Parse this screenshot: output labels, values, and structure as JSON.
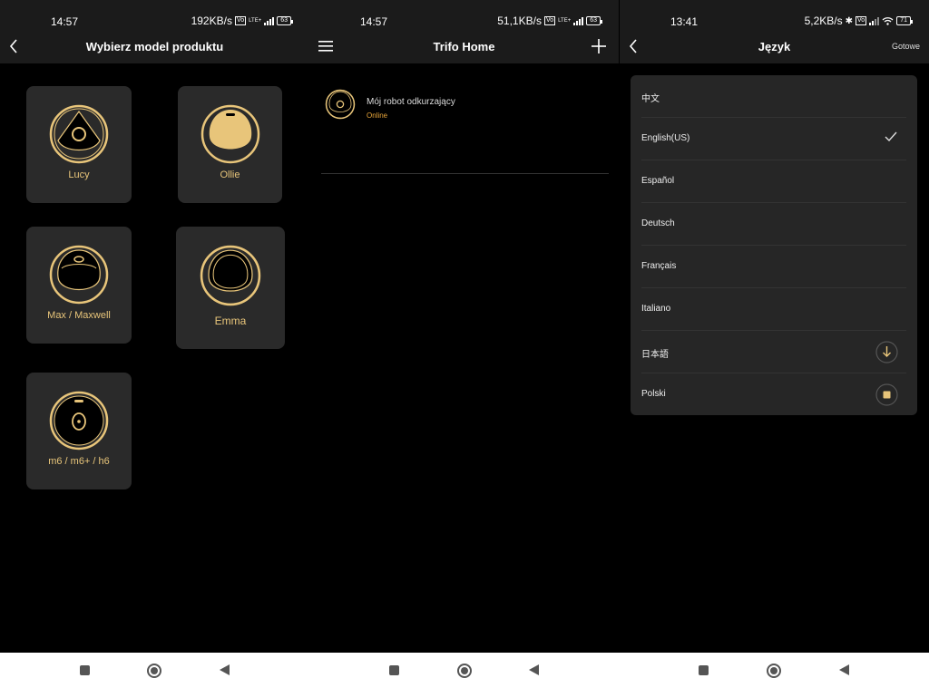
{
  "panel1": {
    "status": {
      "time": "14:57",
      "speed": "192KB/s",
      "net": "LTE+",
      "battery": "63"
    },
    "title": "Wybierz model produktu",
    "models": [
      {
        "label": "Lucy"
      },
      {
        "label": "Ollie"
      },
      {
        "label": "Max / Maxwell"
      },
      {
        "label": "Emma"
      },
      {
        "label": "m6 / m6+ / h6"
      }
    ]
  },
  "panel2": {
    "status": {
      "time": "14:57",
      "speed": "51,1KB/s",
      "net": "LTE+",
      "battery": "63"
    },
    "title": "Trifo Home",
    "device": {
      "name": "Mój robot odkurzający",
      "status": "Online"
    }
  },
  "panel3": {
    "status": {
      "time": "13:41",
      "speed": "5,2KB/s",
      "battery": "71"
    },
    "title": "Język",
    "done": "Gotowe",
    "languages": [
      {
        "label": "中文",
        "icon": ""
      },
      {
        "label": "English(US)",
        "icon": "check-icon"
      },
      {
        "label": "Español",
        "icon": ""
      },
      {
        "label": "Deutsch",
        "icon": ""
      },
      {
        "label": "Français",
        "icon": ""
      },
      {
        "label": "Italiano",
        "icon": ""
      },
      {
        "label": "日本語",
        "icon": "download-icon"
      },
      {
        "label": "Polski",
        "icon": "stop-icon"
      }
    ]
  },
  "colors": {
    "accent": "#e8c57a",
    "bg": "#000000",
    "bar": "#1b1b1b",
    "card": "#2a2a2a",
    "online": "#e8a53a"
  }
}
